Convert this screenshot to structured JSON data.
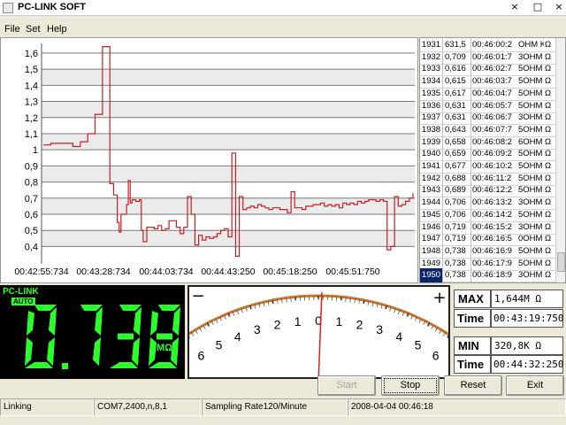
{
  "window": {
    "title": "PC-LINK SOFT",
    "controls": [
      "×",
      "□",
      "×"
    ]
  },
  "menu": [
    {
      "label": "File"
    },
    {
      "label": "Set"
    },
    {
      "label": "Help"
    }
  ],
  "chart_data": {
    "type": "line",
    "title": "",
    "xlabel": "",
    "ylabel": "",
    "y_ticks": [
      "0,4",
      "0,5",
      "0,6",
      "0,7",
      "0,8",
      "0,9",
      "1",
      "1,1",
      "1,2",
      "1,3",
      "1,4",
      "1,5",
      "1,6"
    ],
    "x_ticks": [
      "00:42:55:734",
      "00:43:28:734",
      "00:44:03:734",
      "00:44:43:250",
      "00:45:18:250",
      "00:45:51:750"
    ],
    "ylim": [
      0.32,
      1.66
    ],
    "grid": true,
    "line_color": "#c82020",
    "series": [
      {
        "name": "",
        "x": [
          0,
          2,
          5,
          8,
          10,
          12,
          14,
          16,
          17,
          18,
          19,
          19.5,
          20,
          20.5,
          21,
          22,
          22.5,
          23,
          23.5,
          24,
          25,
          26,
          26.5,
          27,
          28,
          29,
          30,
          31,
          32,
          33,
          34,
          35,
          36,
          37,
          38,
          39,
          40,
          41,
          42,
          43,
          44,
          45,
          46,
          47,
          48,
          49,
          50,
          51,
          52,
          53,
          54,
          55,
          56,
          57,
          58,
          59,
          60,
          61,
          62,
          63,
          64,
          65,
          66,
          67,
          68,
          69,
          70,
          71,
          72,
          73,
          74,
          75,
          76,
          77,
          78,
          79,
          80,
          81,
          82,
          83,
          84,
          85,
          86,
          87,
          88,
          89,
          90,
          91,
          92,
          93,
          94,
          95,
          96,
          97,
          98,
          99,
          100
        ],
        "y": [
          1.03,
          1.04,
          1.04,
          1.02,
          1.05,
          1.1,
          1.22,
          1.64,
          1.64,
          0.79,
          0.72,
          0.72,
          0.55,
          0.49,
          0.6,
          0.6,
          0.66,
          0.81,
          0.67,
          0.69,
          0.68,
          0.69,
          0.5,
          0.43,
          0.52,
          0.52,
          0.51,
          0.53,
          0.5,
          0.51,
          0.56,
          0.56,
          0.52,
          0.48,
          0.52,
          0.71,
          0.6,
          0.41,
          0.47,
          0.44,
          0.46,
          0.45,
          0.46,
          0.48,
          0.5,
          0.51,
          0.46,
          0.98,
          0.34,
          0.71,
          0.63,
          0.64,
          0.65,
          0.64,
          0.66,
          0.65,
          0.64,
          0.63,
          0.64,
          0.64,
          0.63,
          0.63,
          0.61,
          0.74,
          0.64,
          0.64,
          0.63,
          0.65,
          0.65,
          0.66,
          0.66,
          0.67,
          0.65,
          0.66,
          0.65,
          0.66,
          0.64,
          0.67,
          0.66,
          0.67,
          0.66,
          0.68,
          0.67,
          0.68,
          0.69,
          0.69,
          0.68,
          0.69,
          0.68,
          0.38,
          0.4,
          0.71,
          0.65,
          0.66,
          0.68,
          0.7,
          0.73
        ]
      }
    ]
  },
  "log": {
    "rows": [
      {
        "index": "1931",
        "value": "631,5",
        "time": "00:46:00:2",
        "unit": "OHM K",
        "sym": "Ω"
      },
      {
        "index": "1932",
        "value": "0,709",
        "time": "00:46:01:7",
        "unit": "3OHM M",
        "sym": "Ω"
      },
      {
        "index": "1933",
        "value": "0,616",
        "time": "00:46:02:7",
        "unit": "5OHM M",
        "sym": "Ω"
      },
      {
        "index": "1934",
        "value": "0,615",
        "time": "00:46:03:7",
        "unit": "5OHM M",
        "sym": "Ω"
      },
      {
        "index": "1935",
        "value": "0,617",
        "time": "00:46:04:7",
        "unit": "5OHM M",
        "sym": "Ω"
      },
      {
        "index": "1936",
        "value": "0,631",
        "time": "00:46:05:7",
        "unit": "5OHM M",
        "sym": "Ω"
      },
      {
        "index": "1937",
        "value": "0,631",
        "time": "00:46:06:7",
        "unit": "3OHM M",
        "sym": "Ω"
      },
      {
        "index": "1938",
        "value": "0,643",
        "time": "00:46:07:7",
        "unit": "5OHM M",
        "sym": "Ω"
      },
      {
        "index": "1939",
        "value": "0,658",
        "time": "00:46:08:2",
        "unit": "6OHM M",
        "sym": "Ω"
      },
      {
        "index": "1940",
        "value": "0,659",
        "time": "00:46:09:2",
        "unit": "5OHM M",
        "sym": "Ω"
      },
      {
        "index": "1941",
        "value": "0,677",
        "time": "00:46:10:2",
        "unit": "5OHM M",
        "sym": "Ω"
      },
      {
        "index": "1942",
        "value": "0,688",
        "time": "00:46:11:2",
        "unit": "5OHM M",
        "sym": "Ω"
      },
      {
        "index": "1943",
        "value": "0,689",
        "time": "00:46:12:2",
        "unit": "5OHM M",
        "sym": "Ω"
      },
      {
        "index": "1944",
        "value": "0,706",
        "time": "00:46:13:2",
        "unit": "3OHM M",
        "sym": "Ω"
      },
      {
        "index": "1945",
        "value": "0,706",
        "time": "00:46:14:2",
        "unit": "5OHM M",
        "sym": "Ω"
      },
      {
        "index": "1946",
        "value": "0,719",
        "time": "00:46:15:2",
        "unit": "3OHM M",
        "sym": "Ω"
      },
      {
        "index": "1947",
        "value": "0,719",
        "time": "00:46:16:5",
        "unit": "0OHM M",
        "sym": "Ω"
      },
      {
        "index": "1948",
        "value": "0,738",
        "time": "00:46:16:9",
        "unit": "5OHM M",
        "sym": "Ω"
      },
      {
        "index": "1949",
        "value": "0,738",
        "time": "00:46:17:9",
        "unit": "5OHM M",
        "sym": "Ω"
      },
      {
        "index": "1950",
        "value": "0,738",
        "time": "00:46:18:9",
        "unit": "3OHM M",
        "sym": "Ω"
      }
    ]
  },
  "lcd": {
    "brand": "PC-LINK",
    "mode": "AUTO",
    "reading": "0.738",
    "unit": "MΩ",
    "color": "#2bff2b"
  },
  "analog": {
    "left_marker": "−",
    "right_marker": "+",
    "scale_labels": [
      "6",
      "5",
      "4",
      "3",
      "2",
      "1",
      "0",
      "1",
      "2",
      "3",
      "4",
      "5",
      "6"
    ],
    "colors": {
      "negative": "#d62020",
      "center": "#1aa01a",
      "positive": "#d62020"
    },
    "needle_value": 0.15
  },
  "max": {
    "label": "MAX",
    "value": "1,644M  Ω",
    "time_label": "Time",
    "time": "00:43:19:750"
  },
  "min": {
    "label": "MIN",
    "value": "320,8K  Ω",
    "time_label": "Time",
    "time": "00:44:32:250"
  },
  "buttons": {
    "start": "Start",
    "stop": "Stop",
    "reset": "Reset",
    "exit": "Exit"
  },
  "status": {
    "state": "Linking",
    "port": "COM7,2400,n,8,1",
    "sampling": "Sampling Rate120/Minute",
    "datetime": "2008-04-04 00:46:18"
  }
}
